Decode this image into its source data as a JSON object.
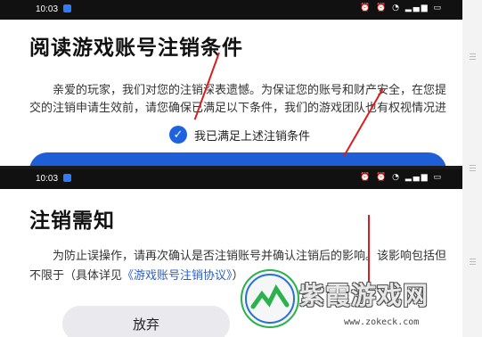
{
  "top_screen": {
    "status_time": "10:03",
    "status_icons": "⏰ ⏰ ◔ ▂▄▆ ▭",
    "title": "阅读游戏账号注销条件",
    "paragraph_line1": "亲爱的玩家，我们对您的注销深表遗憾。为保证您的账号和财产安全，在您提",
    "paragraph_line2": "交的注销申请生效前，请您确保已满足以下条件，我们的游戏团队也有权视情况进",
    "checkbox_label": "我已满足上述注销条件",
    "checkbox_checked": true,
    "primary_button_color": "#1e5fd8"
  },
  "bottom_screen": {
    "status_time": "10:03",
    "status_icons": "⏰ ⏰ ◔ ▂▄▆ ▭",
    "title": "注销需知",
    "paragraph_line1": "为防止误操作，请再次确认是否注销账号并确认注销后的影响。该影响包括但",
    "paragraph_line2_prefix": "不限于（具体详见",
    "paragraph_link": "《游戏账号注销协议》",
    "paragraph_line2_suffix": "）",
    "abandon_button": "放弃"
  },
  "watermark": {
    "text": "紫霞游戏网",
    "url": "www.zokeck.com"
  },
  "colors": {
    "accent": "#1e62e0",
    "arrow": "#d81e1e",
    "link": "#2a5fc9"
  }
}
